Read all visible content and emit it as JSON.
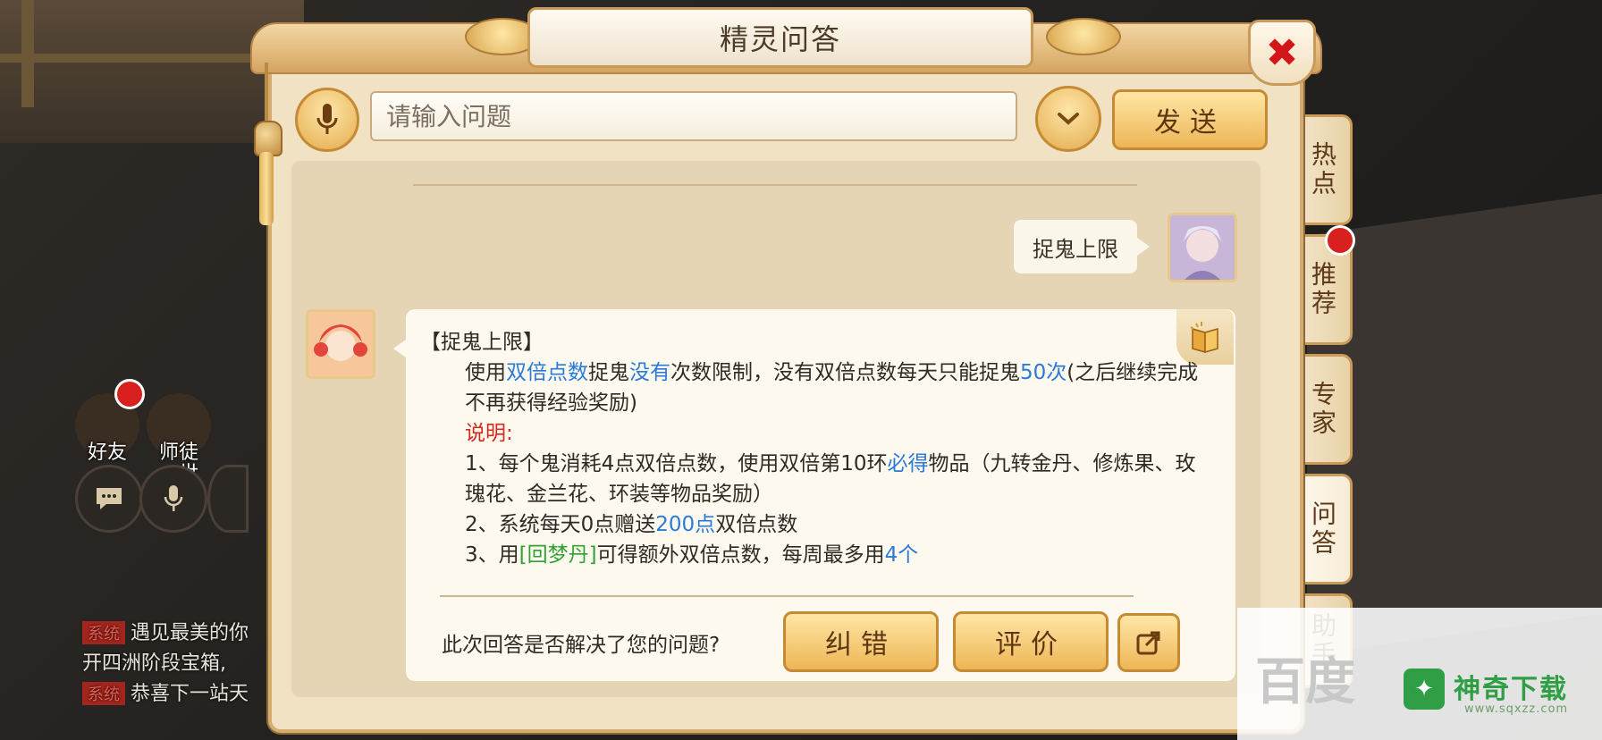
{
  "dialog": {
    "title": "精灵问答",
    "close_icon": "close-icon"
  },
  "input": {
    "placeholder": "请输入问题",
    "send_label": "发送"
  },
  "side_tabs": [
    {
      "label": "热点",
      "badge": false,
      "active": false
    },
    {
      "label": "推荐",
      "badge": true,
      "active": false
    },
    {
      "label": "专家",
      "badge": false,
      "active": false
    },
    {
      "label": "问答",
      "badge": false,
      "active": true
    },
    {
      "label": "助手",
      "badge": false,
      "active": false
    }
  ],
  "conversation": {
    "user_message": "捉鬼上限",
    "answer": {
      "title": "【捉鬼上限】",
      "p1": [
        "使用",
        "双倍点数",
        "捉鬼",
        "没有",
        "次数限制，没有双倍点数每天只能捉鬼",
        "50次",
        "(之后继续完成不再获得经验奖励)"
      ],
      "note_label": "说明:",
      "item1": [
        "1、每个鬼消耗4点双倍点数，使用双倍第10环",
        "必得",
        "物品（九转金丹、修炼果、玫瑰花、金兰花、环装等物品奖励）"
      ],
      "item2": [
        "2、系统每天0点赠送",
        "200点",
        "双倍点数"
      ],
      "item3": [
        "3、用",
        "[回梦丹]",
        "可得额外双倍点数，每周最多用",
        "4个"
      ]
    },
    "feedback_question": "此次回答是否解决了您的问题?",
    "correct_label": "纠错",
    "rate_label": "评价"
  },
  "hud": {
    "friends_label": "好友",
    "master_label": "师徒",
    "world_label": "世",
    "chat_lines": [
      {
        "tag": "系统",
        "text": "遇见最美的你"
      },
      {
        "tag": "",
        "text": "开四洲阶段宝箱,"
      },
      {
        "tag": "系统",
        "text": "恭喜下一站天"
      }
    ]
  },
  "watermark": {
    "baidu": "百度",
    "site_name": "神奇下载",
    "site_url": "www.sqxzz.com"
  },
  "colors": {
    "link_blue": "#2a7ad8",
    "note_red": "#d42a1d",
    "item_green": "#32a232",
    "button_gold": "#edb657"
  }
}
